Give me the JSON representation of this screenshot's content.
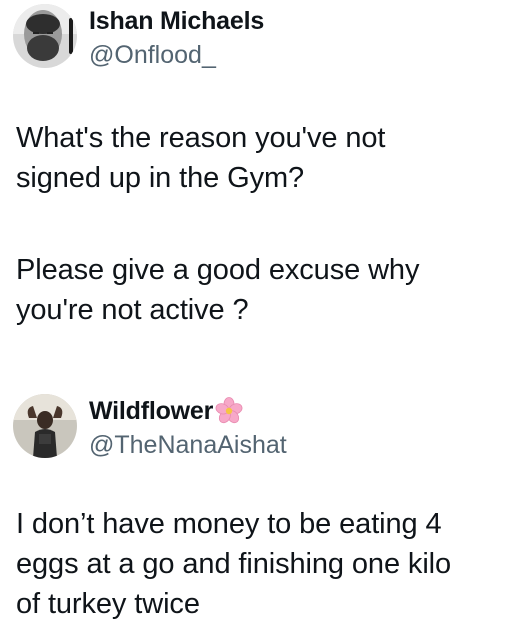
{
  "tweets": [
    {
      "author": {
        "display_name": "Ishan Michaels",
        "handle": "@Onflood_",
        "avatar_icon": "grayscale-bearded-man-avatar"
      },
      "paragraphs": [
        "What's the reason you've not\nsigned up in the Gym?",
        "Please give a good excuse why\nyou're not active ?"
      ]
    },
    {
      "author": {
        "display_name": "Wildflower",
        "name_emoji": "cherry-blossom-icon",
        "handle": "@TheNanaAishat",
        "avatar_icon": "woman-flexing-avatar"
      },
      "paragraphs": [
        "I don’t have money to be eating 4\neggs at a go and finishing one kilo\nof turkey twice"
      ]
    }
  ],
  "colors": {
    "text_primary": "#0f1419",
    "text_secondary": "#536471",
    "background": "#ffffff",
    "blossom_pink": "#f7a8c8"
  }
}
